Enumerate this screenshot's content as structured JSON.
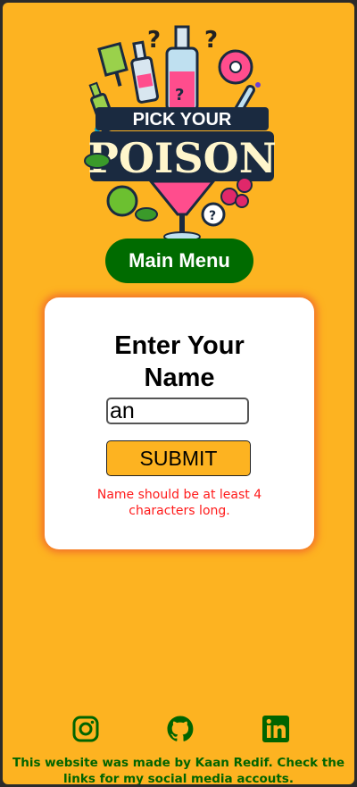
{
  "logo": {
    "text_line1": "PICK YOUR",
    "text_line2": "POISON"
  },
  "nav": {
    "main_menu_label": "Main Menu"
  },
  "form": {
    "title": "Enter Your\nName",
    "name_value": "an",
    "submit_label": "SUBMIT",
    "error_message": "Name should be at least 4 characters long."
  },
  "footer": {
    "icons": [
      "instagram-icon",
      "github-icon",
      "linkedin-icon"
    ],
    "text": "This website was made by Kaan Redif. Check the links for my social media accouts."
  },
  "colors": {
    "background": "#fdb321",
    "button_green": "#006b00",
    "footer_text": "#006400",
    "error": "#ff1a1a",
    "card_glow": "#f26b2a"
  }
}
